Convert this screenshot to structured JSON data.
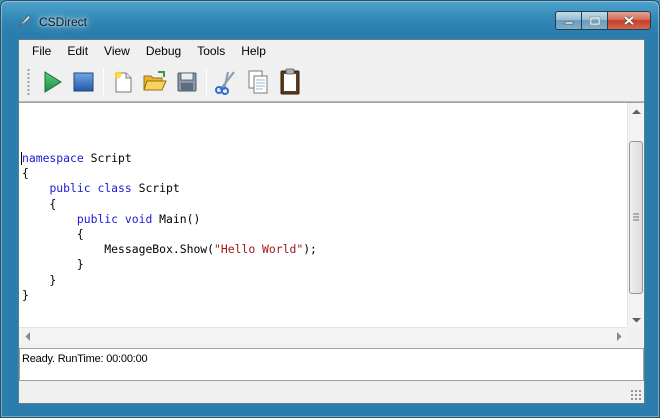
{
  "window": {
    "title": "CSDirect"
  },
  "menu": [
    "File",
    "Edit",
    "View",
    "Debug",
    "Tools",
    "Help"
  ],
  "toolbar": {
    "buttons": [
      {
        "name": "run-button",
        "icon": "play-icon"
      },
      {
        "name": "stop-button",
        "icon": "stop-icon"
      },
      {
        "name": "new-button",
        "icon": "new-file-icon"
      },
      {
        "name": "open-button",
        "icon": "open-folder-icon"
      },
      {
        "name": "save-button",
        "icon": "floppy-disk-icon"
      },
      {
        "name": "cut-button",
        "icon": "scissors-icon"
      },
      {
        "name": "copy-button",
        "icon": "copy-icon"
      },
      {
        "name": "paste-button",
        "icon": "clipboard-icon"
      }
    ]
  },
  "editor": {
    "lines": [
      "namespace Script",
      "{",
      "    public class Script",
      "    {",
      "        public void Main()",
      "        {",
      "            MessageBox.Show(\"Hello World\");",
      "        }",
      "    }",
      "}"
    ]
  },
  "status": {
    "text": "Ready. RunTime: 00:00:00"
  },
  "colors": {
    "keyword": "#1a1ad6",
    "string": "#a31515",
    "titlebar": "#2f86b4",
    "close_button": "#c2402a"
  }
}
